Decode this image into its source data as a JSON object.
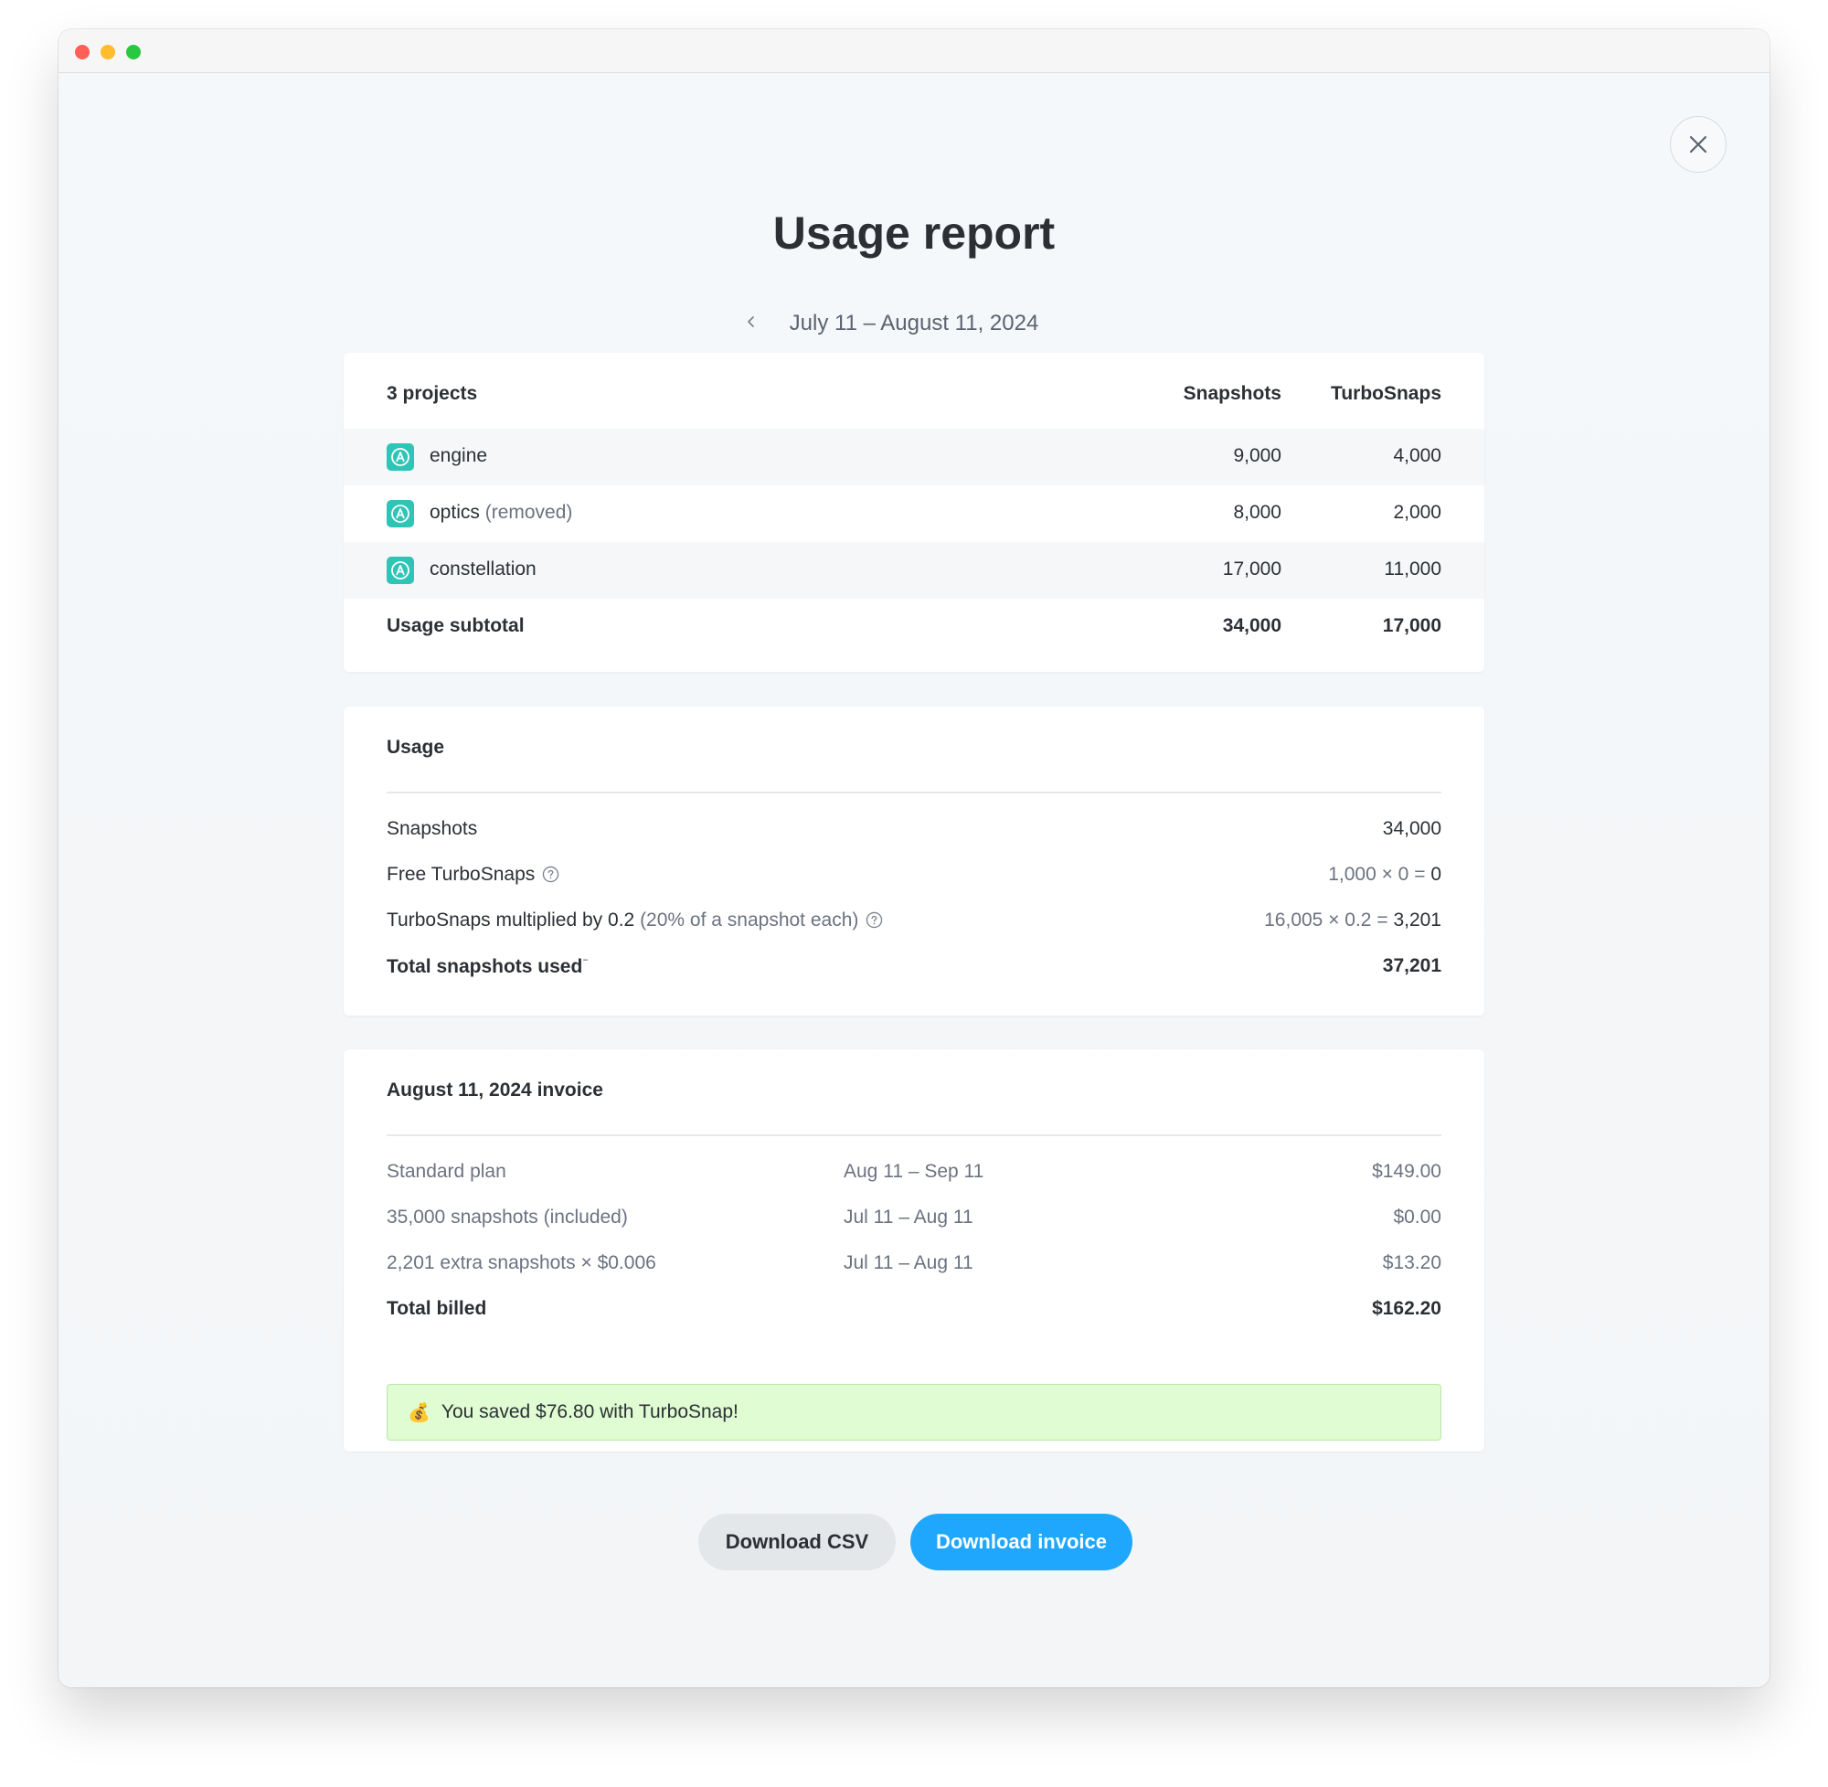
{
  "modal": {
    "title": "Usage report",
    "period": "July 11 – August 11, 2024"
  },
  "projects": {
    "header": {
      "label": "3 projects",
      "snapshots": "Snapshots",
      "turbosnaps": "TurboSnaps"
    },
    "rows": [
      {
        "name": "engine",
        "note": "",
        "snapshots": "9,000",
        "turbosnaps": "4,000"
      },
      {
        "name": "optics",
        "note": "(removed)",
        "snapshots": "8,000",
        "turbosnaps": "2,000"
      },
      {
        "name": "constellation",
        "note": "",
        "snapshots": "17,000",
        "turbosnaps": "11,000"
      }
    ],
    "subtotal": {
      "label": "Usage subtotal",
      "snapshots": "34,000",
      "turbosnaps": "17,000"
    }
  },
  "usage": {
    "heading": "Usage",
    "snapshots": {
      "label": "Snapshots",
      "value": "34,000"
    },
    "free_turbosnaps": {
      "label": "Free TurboSnaps",
      "calc": "1,000 × 0 =",
      "value": "0"
    },
    "multiplied": {
      "label": "TurboSnaps multiplied by 0.2",
      "note": "(20% of a snapshot each)",
      "calc": "16,005 × 0.2 =",
      "value": "3,201"
    },
    "total": {
      "label": "Total snapshots used",
      "value": "37,201"
    }
  },
  "invoice": {
    "heading": "August 11, 2024 invoice",
    "lines": [
      {
        "label": "Standard plan",
        "period": "Aug 11 – Sep 11",
        "amount": "$149.00"
      },
      {
        "label": "35,000 snapshots (included)",
        "period": "Jul 11 – Aug 11",
        "amount": "$0.00"
      },
      {
        "label": "2,201 extra snapshots × $0.006",
        "period": "Jul 11 – Aug 11",
        "amount": "$13.20"
      }
    ],
    "total": {
      "label": "Total billed",
      "amount": "$162.20"
    },
    "savings": {
      "emoji": "💰",
      "text": "You saved $76.80 with TurboSnap!"
    }
  },
  "actions": {
    "download_csv": "Download CSV",
    "download_invoice": "Download invoice"
  },
  "icons": {
    "close": "close-icon",
    "prev": "chevron-left-icon",
    "project": "project-icon",
    "help": "help-circle-icon"
  },
  "colors": {
    "primary": "#1ea7fd",
    "project_icon": "#2ec4b6",
    "savings_bg": "#dffcd2"
  }
}
